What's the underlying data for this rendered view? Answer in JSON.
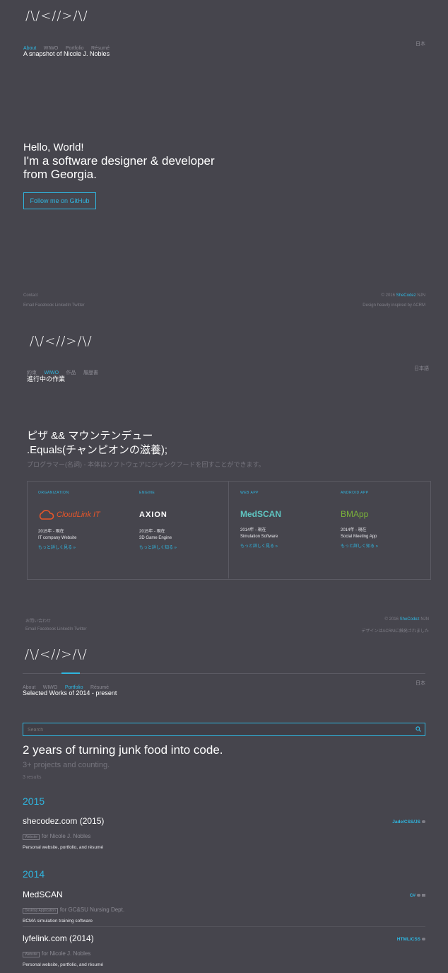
{
  "section1": {
    "logo": "/\\/<//>/\\/",
    "nav": [
      "About",
      "WIWO",
      "Portfolio",
      "Résumé"
    ],
    "lang": "日本",
    "subtitle": "A snapshot of Nicole J. Nobles",
    "hello": "Hello, World!",
    "line2": "I'm a software designer & developer",
    "line3": "from Georgia.",
    "button": "Follow me on GitHub",
    "footer": {
      "contact": "Contact",
      "socials": [
        "Email",
        "Facebook",
        "LinkedIn",
        "Twitter"
      ],
      "copyright_prefix": "© 2016",
      "copyright_brand": "SheCodez",
      "copyright_suffix": "NJN",
      "credit": "Design heavily inspired by ACRM"
    }
  },
  "section2": {
    "logo": "/\\/<//>/\\/",
    "nav": [
      "約束",
      "WIWO",
      "作品",
      "履歴書"
    ],
    "lang": "日本語",
    "subtitle": "進行中の作業",
    "headline1": "ピザ && マウンテンデュー",
    "headline2": ".Equals(チャンピオンの滋養);",
    "tagline": "プログラマー(名詞) - 本体はソフトウェアにジャンクフードを回すことができます。",
    "cards": [
      {
        "category": "ORGANIZATION",
        "logo": "CloudLink IT",
        "date": "2015年 - 現在",
        "desc": "IT company Website",
        "more": "もっと詳しく見る »",
        "color": "#e8562a"
      },
      {
        "category": "ENGINE",
        "logo": "AXION",
        "date": "2015年 - 現在",
        "desc": "3D Game Engine",
        "more": "もっと詳しく知る »",
        "color": "#ffffff"
      },
      {
        "category": "WEB APP",
        "logo": "MedSCAN",
        "date": "2014年 - 現在",
        "desc": "Simulation Software",
        "more": "もっと詳しく見る »",
        "color": "#5fc6c2"
      },
      {
        "category": "ANDROID APP",
        "logo": "BMApp",
        "date": "2014年 - 現在",
        "desc": "Social Meeting App",
        "more": "もっと詳しく知る »",
        "color": "#7bb33a"
      }
    ],
    "footer": {
      "contact": "お問い合わせ",
      "socials": [
        "Email",
        "Facebook",
        "LinkedIn",
        "Twitter"
      ],
      "copyright_prefix": "© 2016",
      "copyright_brand": "SheCodez",
      "copyright_suffix": "NJN",
      "credit": "デザインはACRMに触発されました"
    }
  },
  "section3": {
    "logo": "/\\/<//>/\\/",
    "nav": [
      "About",
      "WIWO",
      "Portfolio",
      "Résumé"
    ],
    "lang": "日本",
    "subtitle": "Selected Works of 2014 - present",
    "search_placeholder": "Search",
    "headline": "2 years of turning junk food into code.",
    "subheadline": "3+ projects and counting.",
    "results": "3 results",
    "groups": [
      {
        "year": "2015",
        "items": [
          {
            "title": "shecodez.com (2015)",
            "tag": "Website",
            "for": "for Nicole J. Nobles",
            "desc": "Personal website, portfolio, and résumé",
            "tech": "Jade/CSS/JS"
          }
        ]
      },
      {
        "year": "2014",
        "items": [
          {
            "title": "MedSCAN",
            "tag": "Desktop Application",
            "for": "for GC&SU Nursing Dept.",
            "desc": "BCMA simulation training software",
            "tech": "C#"
          },
          {
            "title": "lyfelink.com (2014)",
            "tag": "Website",
            "for": "for Nicole J. Nobles",
            "desc": "Personal website, portfolio, and résumé",
            "tech": "HTML/CSS"
          }
        ]
      }
    ]
  },
  "colors": {
    "background": "#46454d",
    "accent": "#2fb6e0",
    "muted": "#8c8b94"
  }
}
